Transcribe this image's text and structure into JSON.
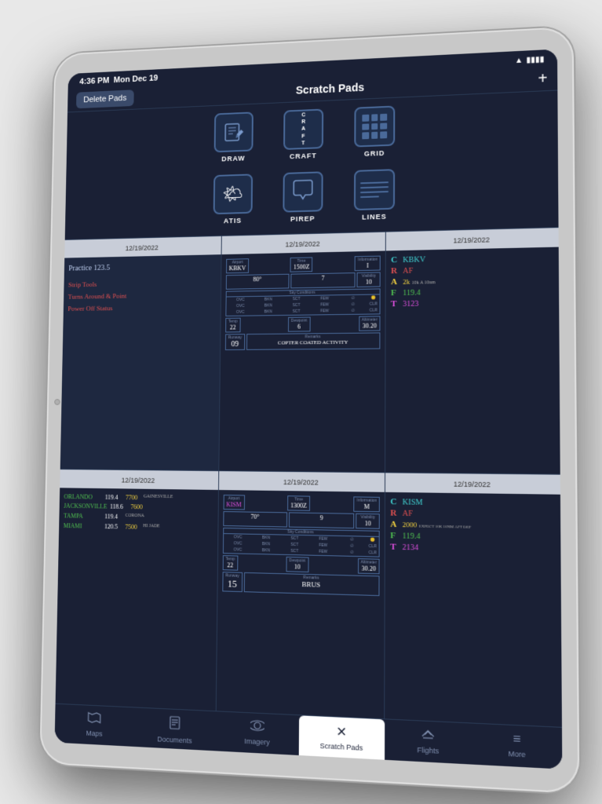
{
  "device": {
    "status_bar": {
      "time": "4:36 PM",
      "date": "Mon Dec 19",
      "battery_icon": "▮▮▮▮",
      "wifi_icon": "▲"
    }
  },
  "header": {
    "delete_pads_label": "Delete Pads",
    "title": "Scratch Pads",
    "add_icon": "+"
  },
  "pad_types": {
    "row1": [
      {
        "id": "draw",
        "label": "DRAW",
        "icon": "✏️"
      },
      {
        "id": "craft",
        "label": "CRAFT"
      },
      {
        "id": "grid",
        "label": "GRID"
      }
    ],
    "row2": [
      {
        "id": "atis",
        "label": "ATIS"
      },
      {
        "id": "pirep",
        "label": "PIREP"
      },
      {
        "id": "lines",
        "label": "LINES"
      }
    ]
  },
  "pad_cards": {
    "row1": [
      {
        "date": "12/19/2022",
        "type": "lines",
        "content": "Practice 123.5\nStrip Tools\nTurns Around & Point\nPower Off Status"
      },
      {
        "date": "12/19/2022",
        "type": "metar",
        "airport": "KBKV",
        "time": "1500Z",
        "info": "I",
        "wind": "80°",
        "gust": "7",
        "visibility": "10",
        "temp": "22",
        "dewpoint": "6",
        "altimeter": "30.20",
        "runway": "09",
        "remarks": "COPTER COATED ACTIVITY"
      },
      {
        "date": "12/19/2022",
        "type": "craft",
        "letters": [
          {
            "letter": "C",
            "value": "KBKV",
            "color": "cyan"
          },
          {
            "letter": "R",
            "value": "AF",
            "color": "red"
          },
          {
            "letter": "A",
            "value": "2k",
            "color": "yellow",
            "note": "10k A 10nm"
          },
          {
            "letter": "F",
            "value": "119.4",
            "color": "green"
          },
          {
            "letter": "T",
            "value": "3123",
            "color": "magenta"
          }
        ]
      }
    ],
    "row2": [
      {
        "date": "12/19/2022",
        "type": "orlando",
        "entries": [
          {
            "name": "ORLANDO",
            "freq": "119.4",
            "alt": "7700",
            "note": "GAINESVILLE"
          },
          {
            "name": "JACKSONVILLE",
            "freq": "118.6",
            "alt": "7600",
            "note": ""
          },
          {
            "name": "TAMPA",
            "freq": "119.4",
            "alt": "",
            "note": "CORONA"
          },
          {
            "name": "MIAMI",
            "freq": "120.5",
            "alt": "7500",
            "note": "HI JADE"
          }
        ]
      },
      {
        "date": "12/19/2022",
        "type": "metar2",
        "airport": "KISM",
        "time": "1300Z",
        "info": "M",
        "wind": "70°",
        "gust": "9",
        "visibility": "10",
        "temp": "22",
        "dewpoint": "10",
        "altimeter": "30.20",
        "runway": "15",
        "remarks": "BRUS"
      },
      {
        "date": "12/19/2022",
        "type": "craft2",
        "letters": [
          {
            "letter": "C",
            "value": "KISM",
            "color": "cyan"
          },
          {
            "letter": "R",
            "value": "AF",
            "color": "red"
          },
          {
            "letter": "A",
            "value": "2000",
            "color": "yellow",
            "note": "EXPECT 10K 10NM AFT DEP"
          },
          {
            "letter": "F",
            "value": "119.4",
            "color": "green"
          },
          {
            "letter": "T",
            "value": "2134",
            "color": "magenta"
          }
        ]
      }
    ]
  },
  "tab_bar": {
    "tabs": [
      {
        "id": "maps",
        "label": "Maps",
        "icon": "⊞",
        "active": false
      },
      {
        "id": "documents",
        "label": "Documents",
        "icon": "📄",
        "active": false
      },
      {
        "id": "imagery",
        "label": "Imagery",
        "icon": "🛰",
        "active": false
      },
      {
        "id": "scratch_pads",
        "label": "Scratch Pads",
        "icon": "✕",
        "active": true
      },
      {
        "id": "flights",
        "label": "Flights",
        "icon": "✈",
        "active": false
      },
      {
        "id": "more",
        "label": "More",
        "icon": "≡",
        "active": false
      }
    ]
  }
}
